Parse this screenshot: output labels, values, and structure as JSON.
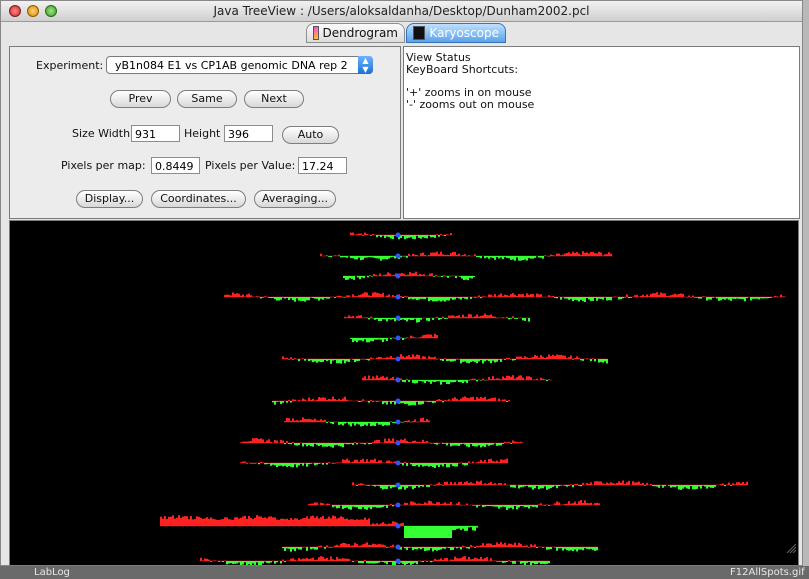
{
  "window": {
    "title": "Java TreeView : /Users/aloksaldanha/Desktop/Dunham2002.pcl"
  },
  "tabs": [
    {
      "label": "Dendrogram",
      "active": false,
      "icon": "dendrogram-icon"
    },
    {
      "label": "Karyoscope",
      "active": true,
      "icon": "karyoscope-icon"
    }
  ],
  "controls": {
    "experiment_label": "Experiment:",
    "experiment_value": "yB1n084 E1 vs CP1AB genomic DNA rep 2",
    "prev_label": "Prev",
    "same_label": "Same",
    "next_label": "Next",
    "size_width_label": "Size Width",
    "size_width_value": "931",
    "height_label": "Height",
    "height_value": "396",
    "auto_label": "Auto",
    "pixels_per_map_label": "Pixels per map:",
    "pixels_per_map_value": "0.8449",
    "pixels_per_value_label": "Pixels per Value:",
    "pixels_per_value_value": "17.24",
    "display_label": "Display...",
    "coordinates_label": "Coordinates...",
    "averaging_label": "Averaging..."
  },
  "status": {
    "line1": "View Status",
    "line2": "KeyBoard Shortcuts:",
    "line3": "'+' zooms in on mouse",
    "line4": "'-' zooms out on mouse"
  },
  "desktop": {
    "left_label": "LabLog",
    "right_label": "F12AllSpots.gif"
  },
  "colors": {
    "positive": "#ff2020",
    "negative": "#33ff33",
    "centromere": "#3355ff",
    "background": "#000000"
  }
}
